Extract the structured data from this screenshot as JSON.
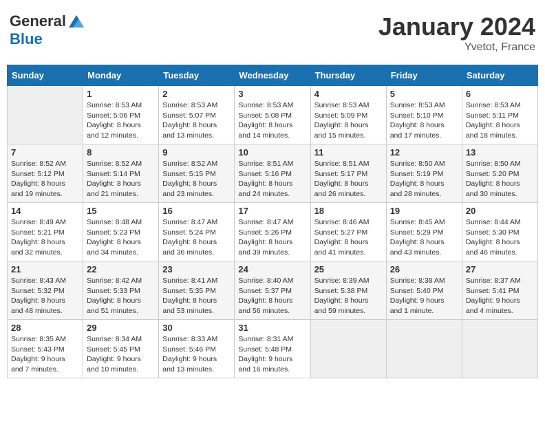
{
  "header": {
    "logo_line1": "General",
    "logo_line2": "Blue",
    "month_title": "January 2024",
    "location": "Yvetot, France"
  },
  "weekdays": [
    "Sunday",
    "Monday",
    "Tuesday",
    "Wednesday",
    "Thursday",
    "Friday",
    "Saturday"
  ],
  "weeks": [
    [
      {
        "day": "",
        "sunrise": "",
        "sunset": "",
        "daylight": ""
      },
      {
        "day": "1",
        "sunrise": "Sunrise: 8:53 AM",
        "sunset": "Sunset: 5:06 PM",
        "daylight": "Daylight: 8 hours and 12 minutes."
      },
      {
        "day": "2",
        "sunrise": "Sunrise: 8:53 AM",
        "sunset": "Sunset: 5:07 PM",
        "daylight": "Daylight: 8 hours and 13 minutes."
      },
      {
        "day": "3",
        "sunrise": "Sunrise: 8:53 AM",
        "sunset": "Sunset: 5:08 PM",
        "daylight": "Daylight: 8 hours and 14 minutes."
      },
      {
        "day": "4",
        "sunrise": "Sunrise: 8:53 AM",
        "sunset": "Sunset: 5:09 PM",
        "daylight": "Daylight: 8 hours and 15 minutes."
      },
      {
        "day": "5",
        "sunrise": "Sunrise: 8:53 AM",
        "sunset": "Sunset: 5:10 PM",
        "daylight": "Daylight: 8 hours and 17 minutes."
      },
      {
        "day": "6",
        "sunrise": "Sunrise: 8:53 AM",
        "sunset": "Sunset: 5:11 PM",
        "daylight": "Daylight: 8 hours and 18 minutes."
      }
    ],
    [
      {
        "day": "7",
        "sunrise": "Sunrise: 8:52 AM",
        "sunset": "Sunset: 5:12 PM",
        "daylight": "Daylight: 8 hours and 19 minutes."
      },
      {
        "day": "8",
        "sunrise": "Sunrise: 8:52 AM",
        "sunset": "Sunset: 5:14 PM",
        "daylight": "Daylight: 8 hours and 21 minutes."
      },
      {
        "day": "9",
        "sunrise": "Sunrise: 8:52 AM",
        "sunset": "Sunset: 5:15 PM",
        "daylight": "Daylight: 8 hours and 23 minutes."
      },
      {
        "day": "10",
        "sunrise": "Sunrise: 8:51 AM",
        "sunset": "Sunset: 5:16 PM",
        "daylight": "Daylight: 8 hours and 24 minutes."
      },
      {
        "day": "11",
        "sunrise": "Sunrise: 8:51 AM",
        "sunset": "Sunset: 5:17 PM",
        "daylight": "Daylight: 8 hours and 26 minutes."
      },
      {
        "day": "12",
        "sunrise": "Sunrise: 8:50 AM",
        "sunset": "Sunset: 5:19 PM",
        "daylight": "Daylight: 8 hours and 28 minutes."
      },
      {
        "day": "13",
        "sunrise": "Sunrise: 8:50 AM",
        "sunset": "Sunset: 5:20 PM",
        "daylight": "Daylight: 8 hours and 30 minutes."
      }
    ],
    [
      {
        "day": "14",
        "sunrise": "Sunrise: 8:49 AM",
        "sunset": "Sunset: 5:21 PM",
        "daylight": "Daylight: 8 hours and 32 minutes."
      },
      {
        "day": "15",
        "sunrise": "Sunrise: 8:48 AM",
        "sunset": "Sunset: 5:23 PM",
        "daylight": "Daylight: 8 hours and 34 minutes."
      },
      {
        "day": "16",
        "sunrise": "Sunrise: 8:47 AM",
        "sunset": "Sunset: 5:24 PM",
        "daylight": "Daylight: 8 hours and 36 minutes."
      },
      {
        "day": "17",
        "sunrise": "Sunrise: 8:47 AM",
        "sunset": "Sunset: 5:26 PM",
        "daylight": "Daylight: 8 hours and 39 minutes."
      },
      {
        "day": "18",
        "sunrise": "Sunrise: 8:46 AM",
        "sunset": "Sunset: 5:27 PM",
        "daylight": "Daylight: 8 hours and 41 minutes."
      },
      {
        "day": "19",
        "sunrise": "Sunrise: 8:45 AM",
        "sunset": "Sunset: 5:29 PM",
        "daylight": "Daylight: 8 hours and 43 minutes."
      },
      {
        "day": "20",
        "sunrise": "Sunrise: 8:44 AM",
        "sunset": "Sunset: 5:30 PM",
        "daylight": "Daylight: 8 hours and 46 minutes."
      }
    ],
    [
      {
        "day": "21",
        "sunrise": "Sunrise: 8:43 AM",
        "sunset": "Sunset: 5:32 PM",
        "daylight": "Daylight: 8 hours and 48 minutes."
      },
      {
        "day": "22",
        "sunrise": "Sunrise: 8:42 AM",
        "sunset": "Sunset: 5:33 PM",
        "daylight": "Daylight: 8 hours and 51 minutes."
      },
      {
        "day": "23",
        "sunrise": "Sunrise: 8:41 AM",
        "sunset": "Sunset: 5:35 PM",
        "daylight": "Daylight: 8 hours and 53 minutes."
      },
      {
        "day": "24",
        "sunrise": "Sunrise: 8:40 AM",
        "sunset": "Sunset: 5:37 PM",
        "daylight": "Daylight: 8 hours and 56 minutes."
      },
      {
        "day": "25",
        "sunrise": "Sunrise: 8:39 AM",
        "sunset": "Sunset: 5:38 PM",
        "daylight": "Daylight: 8 hours and 59 minutes."
      },
      {
        "day": "26",
        "sunrise": "Sunrise: 8:38 AM",
        "sunset": "Sunset: 5:40 PM",
        "daylight": "Daylight: 9 hours and 1 minute."
      },
      {
        "day": "27",
        "sunrise": "Sunrise: 8:37 AM",
        "sunset": "Sunset: 5:41 PM",
        "daylight": "Daylight: 9 hours and 4 minutes."
      }
    ],
    [
      {
        "day": "28",
        "sunrise": "Sunrise: 8:35 AM",
        "sunset": "Sunset: 5:43 PM",
        "daylight": "Daylight: 9 hours and 7 minutes."
      },
      {
        "day": "29",
        "sunrise": "Sunrise: 8:34 AM",
        "sunset": "Sunset: 5:45 PM",
        "daylight": "Daylight: 9 hours and 10 minutes."
      },
      {
        "day": "30",
        "sunrise": "Sunrise: 8:33 AM",
        "sunset": "Sunset: 5:46 PM",
        "daylight": "Daylight: 9 hours and 13 minutes."
      },
      {
        "day": "31",
        "sunrise": "Sunrise: 8:31 AM",
        "sunset": "Sunset: 5:48 PM",
        "daylight": "Daylight: 9 hours and 16 minutes."
      },
      {
        "day": "",
        "sunrise": "",
        "sunset": "",
        "daylight": ""
      },
      {
        "day": "",
        "sunrise": "",
        "sunset": "",
        "daylight": ""
      },
      {
        "day": "",
        "sunrise": "",
        "sunset": "",
        "daylight": ""
      }
    ]
  ]
}
